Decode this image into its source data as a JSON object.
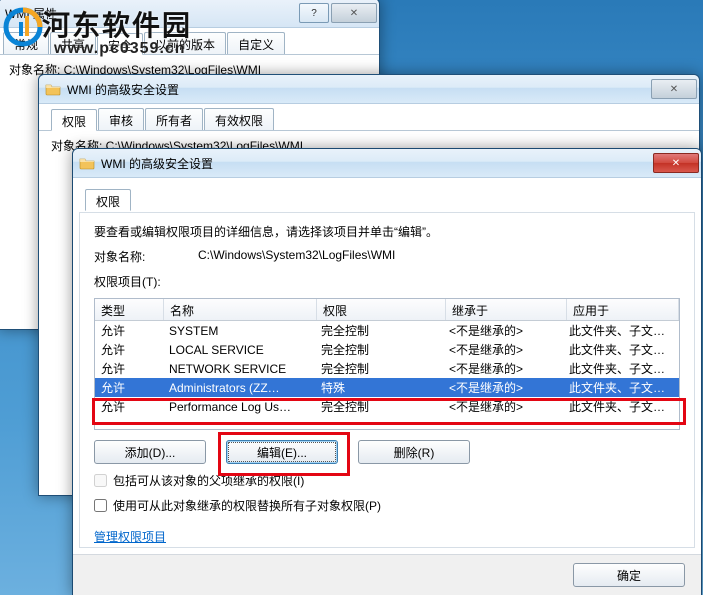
{
  "watermark": {
    "text": "河东软件园",
    "url": "www.pc0359.cn"
  },
  "win1": {
    "title": "WMI 属性",
    "tabs": [
      "常规",
      "共享",
      "安全",
      "以前的版本",
      "自定义"
    ],
    "active_tab": 2,
    "partial": "对象名称:    C:\\Windows\\System32\\LogFiles\\WMI"
  },
  "win2": {
    "title": "WMI 的高级安全设置",
    "tabs": [
      "权限",
      "审核",
      "所有者",
      "有效权限"
    ],
    "active_tab": 0,
    "partial": "对象名称:    C:\\Windows\\System32\\LogFiles\\WMI"
  },
  "win3": {
    "title": "WMI 的高级安全设置",
    "tab_label": "权限",
    "instruction": "要查看或编辑权限项目的详细信息，请选择该项目并单击“编辑”。",
    "object_label": "对象名称:",
    "object_path": "C:\\Windows\\System32\\LogFiles\\WMI",
    "list_label": "权限项目(T):",
    "columns": {
      "type": "类型",
      "name": "名称",
      "perm": "权限",
      "inherit": "继承于",
      "apply": "应用于"
    },
    "rows": [
      {
        "type": "允许",
        "name": "SYSTEM",
        "perm": "完全控制",
        "inherit": "<不是继承的>",
        "apply": "此文件夹、子文件夹…"
      },
      {
        "type": "允许",
        "name": "LOCAL SERVICE",
        "perm": "完全控制",
        "inherit": "<不是继承的>",
        "apply": "此文件夹、子文件夹…"
      },
      {
        "type": "允许",
        "name": "NETWORK SERVICE",
        "perm": "完全控制",
        "inherit": "<不是继承的>",
        "apply": "此文件夹、子文件夹…"
      },
      {
        "type": "允许",
        "name": "Administrators (ZZ…",
        "perm": "特殊",
        "inherit": "<不是继承的>",
        "apply": "此文件夹、子文件夹…"
      },
      {
        "type": "允许",
        "name": "Performance Log Us…",
        "perm": "完全控制",
        "inherit": "<不是继承的>",
        "apply": "此文件夹、子文件夹…"
      }
    ],
    "selected_row_index": 3,
    "buttons": {
      "add": "添加(D)...",
      "edit": "编辑(E)...",
      "remove": "删除(R)"
    },
    "chk1": "包括可从该对象的父项继承的权限(I)",
    "chk2": "使用可从此对象继承的权限替换所有子对象权限(P)",
    "manage_link": "管理权限项目",
    "ok": "确定"
  }
}
